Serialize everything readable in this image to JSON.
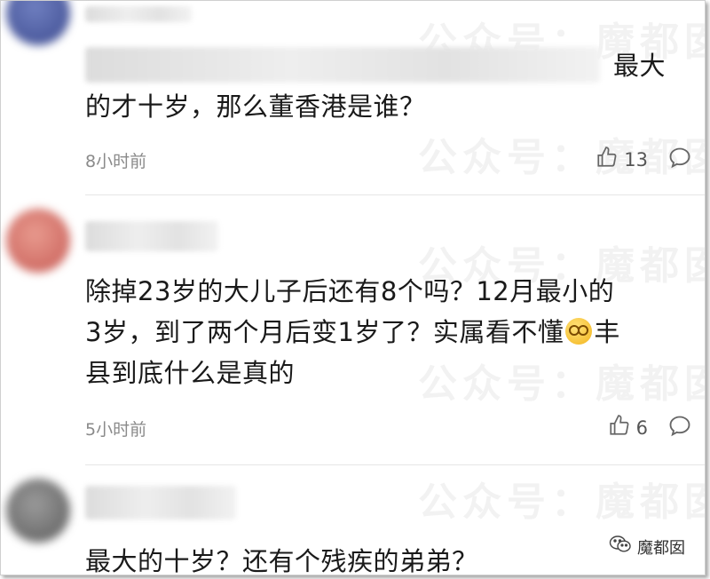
{
  "watermark": {
    "text": "公众号：魔都囡"
  },
  "comments": [
    {
      "text_head": "最大",
      "text_rest": "的才十岁，那么董香港是谁？",
      "time": "8小时前",
      "likes": "13"
    },
    {
      "text_line1": "除掉23岁的大儿子后还有8个吗？12月最小的",
      "text_line2_a": "3岁，到了两个月后变1岁了？实属看不懂",
      "text_line2_b": "丰",
      "text_line3": "县到底什么是真的",
      "time": "5小时前",
      "likes": "6"
    },
    {
      "text": "最大的十岁？还有个残疾的弟弟？"
    }
  ],
  "brand": {
    "name": "魔都囡"
  },
  "colors": {
    "text": "#1a1a1a",
    "meta": "#8a8a8a",
    "divider": "#e6e6e6"
  },
  "icons": [
    "thumbs-up-icon",
    "comment-bubble-icon",
    "wechat-logo-icon",
    "sweat-emoji-icon"
  ]
}
